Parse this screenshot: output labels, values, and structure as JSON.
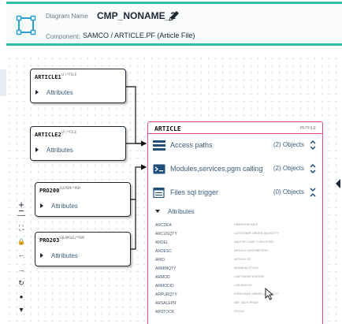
{
  "header": {
    "name_label": "Diagram Name",
    "name_value": "CMP_NONAME_2",
    "component_label": "Component:",
    "component_value": "SAMCO / ARTICLE.PF (Article File)",
    "accent_color": "#2dbfa8",
    "edit_icon": "pencil-icon",
    "diagram_icon": "diagram-frame-icon"
  },
  "entities": [
    {
      "title": "ARTICLE1",
      "type": "LF/*FILE",
      "attr_label": "Attributes"
    },
    {
      "title": "ARTICLE2",
      "type": "LF/*FILE",
      "attr_label": "Attributes"
    },
    {
      "title": "PRO200",
      "type": "ILEPGM/*PGM",
      "attr_label": "Attributes"
    },
    {
      "title": "PRO203",
      "type": "SQLRPGLE/*PGM",
      "attr_label": "Attributes"
    }
  ],
  "target": {
    "title": "ARTICLE",
    "type": "PF/*FILE",
    "border_color": "#e24a8d",
    "rows": [
      {
        "label": "Access paths",
        "count": "(2) Objects",
        "icon": "table-list-icon",
        "toggle": "expand-icon"
      },
      {
        "label": "Modules,services,pgm calling",
        "count": "(2) Objects",
        "icon": "terminal-icon",
        "toggle": "expand-icon"
      },
      {
        "label": "Files sql trigger",
        "count": "(0) Objects",
        "icon": "file-icon",
        "toggle": "collapse-icon"
      }
    ],
    "attributes_label": "Attributes",
    "attributes": [
      {
        "name": "ARCDEA",
        "desc": "CREATION DATE"
      },
      {
        "name": "ARCUSQTY",
        "desc": "CUSTOMER ORDER QUANTITY"
      },
      {
        "name": "ARDEL",
        "desc": "DELETE CODE Y=DELETED"
      },
      {
        "name": "ARDESC",
        "desc": "ARTICLE DESCRIPTION"
      },
      {
        "name": "ARID",
        "desc": "ARTICLE ID"
      },
      {
        "name": "ARMINQTY",
        "desc": "MINIMUM STOCK"
      },
      {
        "name": "ARMOD",
        "desc": "LAST MODIFICATION"
      },
      {
        "name": "ARMODID",
        "desc": "LAS MOD BY"
      },
      {
        "name": "ARPURQTY",
        "desc": "PURCHASE ORDER QUANTITY"
      },
      {
        "name": "ARSALEPR",
        "desc": "NET SALE PRICE"
      },
      {
        "name": "ARSTOCK",
        "desc": "STOCK"
      }
    ]
  },
  "toolbar": {
    "zoom_in": "+",
    "zoom_out": "−",
    "fit": "⛶",
    "lock": "🔒",
    "back": "←",
    "forward": "→",
    "reset": "↻",
    "point": "●",
    "down": "▾"
  }
}
